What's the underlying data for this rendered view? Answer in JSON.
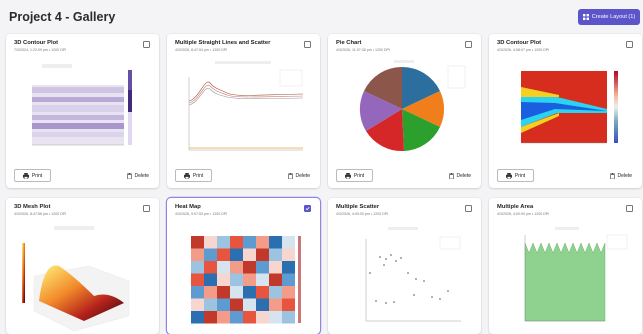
{
  "page": {
    "title": "Project 4 - Gallery",
    "create_layout_label": "Create Layout (1)"
  },
  "card_actions": {
    "print_label": "Print",
    "delete_label": "Delete"
  },
  "cards": [
    {
      "title": "3D Contour Plot",
      "date": "7/3/2024, 1:22:09 pm • 1200 DPI",
      "selected": false
    },
    {
      "title": "Multiple Straight Lines and Scatter",
      "date": "4/3/2026, 8:47:54 pm • 1200 DPI",
      "selected": false
    },
    {
      "title": "Pie Chart",
      "date": "4/3/2026, 11:07:38 pm • 1200 DPI",
      "selected": false
    },
    {
      "title": "3D Contour Plot",
      "date": "4/3/2026, 4:08:07 pm • 1200 DPI",
      "selected": false
    },
    {
      "title": "3D Mesh Plot",
      "date": "4/3/2026, 8:47:56 pm • 1200 DPI",
      "selected": false
    },
    {
      "title": "Heat Map",
      "date": "4/3/2026, 9:07:53 pm • 1200 DPI",
      "selected": true
    },
    {
      "title": "Multiple Scatter",
      "date": "4/3/2026, 4:00:00 pm • 1200 DPI",
      "selected": false
    },
    {
      "title": "Multiple Area",
      "date": "4/3/2026, 4:00:00 pm • 1200 DPI",
      "selected": false
    }
  ],
  "colors": {
    "accent": "#5b55c9"
  }
}
